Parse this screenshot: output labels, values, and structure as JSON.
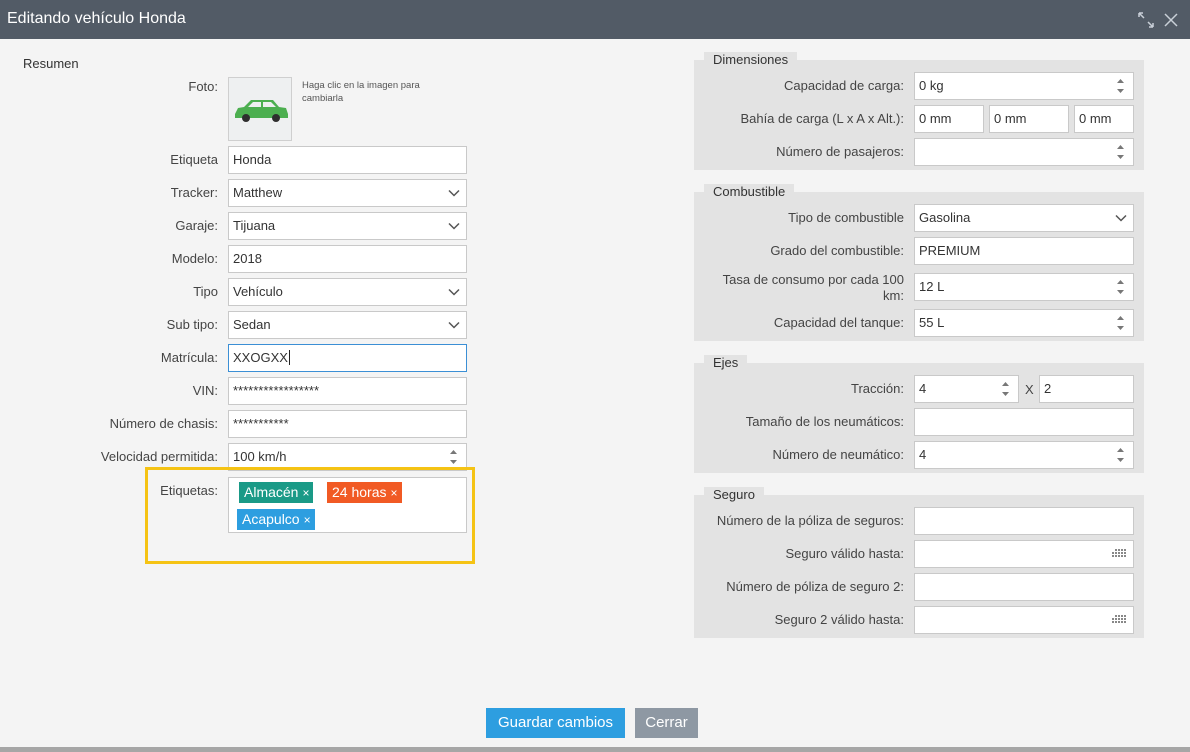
{
  "window": {
    "title": "Editando vehículo Honda"
  },
  "summary": {
    "section_title": "Resumen",
    "photo": {
      "label": "Foto:",
      "hint": "Haga clic en la imagen para cambiarla",
      "car_color": "#4caf50"
    },
    "label_field": {
      "label": "Etiqueta",
      "value": "Honda"
    },
    "tracker": {
      "label": "Tracker:",
      "value": "Matthew"
    },
    "garage": {
      "label": "Garaje:",
      "value": "Tijuana"
    },
    "model": {
      "label": "Modelo:",
      "value": "2018"
    },
    "type": {
      "label": "Tipo",
      "value": "Vehículo"
    },
    "subtype": {
      "label": "Sub tipo:",
      "value": "Sedan"
    },
    "plate": {
      "label": "Matrícula:",
      "value": "XXOGXX"
    },
    "vin": {
      "label": "VIN:",
      "value": "*****************"
    },
    "chassis": {
      "label": "Número de chasis:",
      "value": "***********"
    },
    "speed": {
      "label": "Velocidad permitida:",
      "value": "100 km/h"
    },
    "tags": {
      "label": "Etiquetas:",
      "items": [
        {
          "text": "Almacén",
          "color": "#1a9a87"
        },
        {
          "text": "24 horas",
          "color": "#f15a24"
        },
        {
          "text": "Acapulco",
          "color": "#2d9ee0"
        }
      ],
      "remove_glyph": "×"
    }
  },
  "dimensions": {
    "title": "Dimensiones",
    "capacity": {
      "label": "Capacidad de carga:",
      "value": "0 kg"
    },
    "bay": {
      "label": "Bahía de carga (L x A x Alt.):",
      "length": "0 mm",
      "width": "0 mm",
      "height": "0 mm"
    },
    "passengers": {
      "label": "Número de pasajeros:",
      "value": ""
    }
  },
  "fuel": {
    "title": "Combustible",
    "type": {
      "label": "Tipo de combustible",
      "value": "Gasolina"
    },
    "grade": {
      "label": "Grado del combustible:",
      "value": "PREMIUM"
    },
    "consumption": {
      "label_line1": "Tasa de consumo por cada 100",
      "label_line2": "km:",
      "value": "12 L"
    },
    "tank": {
      "label": "Capacidad del tanque:",
      "value": "55 L"
    }
  },
  "axles": {
    "title": "Ejes",
    "traction": {
      "label": "Tracción:",
      "value1": "4",
      "separator": "X",
      "value2": "2"
    },
    "tire_size": {
      "label": "Tamaño de los neumáticos:",
      "value": ""
    },
    "tire_count": {
      "label": "Número de neumático:",
      "value": "4"
    }
  },
  "insurance": {
    "title": "Seguro",
    "policy": {
      "label": "Número de la póliza de seguros:",
      "value": ""
    },
    "valid_until": {
      "label": "Seguro válido hasta:",
      "value": ""
    },
    "policy2": {
      "label": "Número de póliza de seguro 2:",
      "value": ""
    },
    "valid_until2": {
      "label": "Seguro 2 válido hasta:",
      "value": ""
    }
  },
  "footer": {
    "save_label": "Guardar cambios",
    "close_label": "Cerrar",
    "save_color": "#2d9ee0",
    "close_color": "#8e98a3"
  }
}
